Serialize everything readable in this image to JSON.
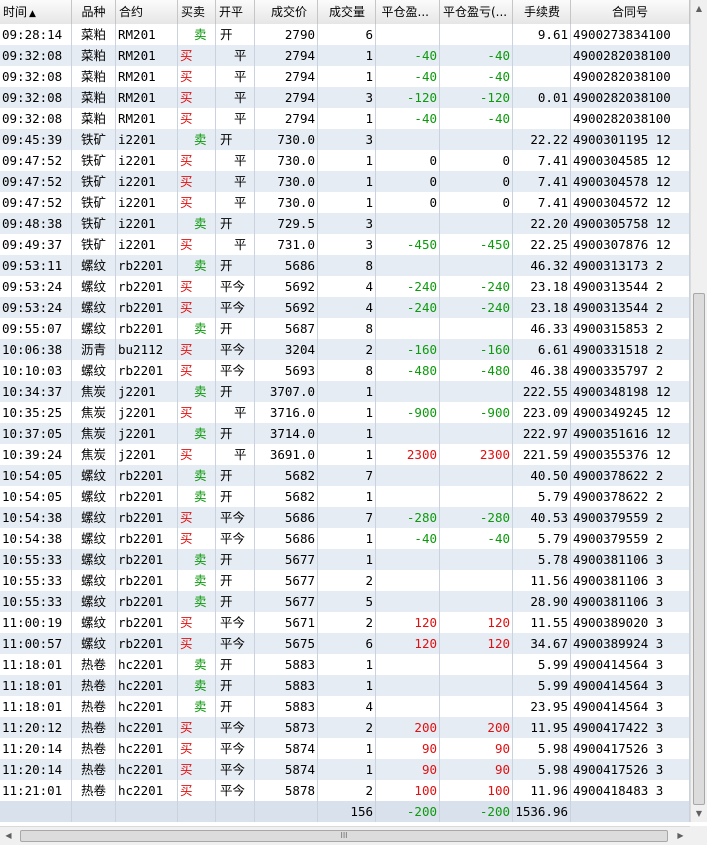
{
  "columns": [
    "时间",
    "品种",
    "合约",
    "买卖",
    "开平",
    "成交价",
    "成交量",
    "平仓盈...",
    "平仓盈亏(...",
    "手续费",
    "合同号"
  ],
  "sort_arrow": "▲",
  "rows": [
    [
      "09:28:14",
      "菜粕",
      "RM201",
      "卖",
      "开",
      "2790",
      "6",
      "",
      "",
      "9.61",
      "4900273834100"
    ],
    [
      "09:32:08",
      "菜粕",
      "RM201",
      "买",
      "平",
      "2794",
      "1",
      "-40",
      "-40",
      "",
      "4900282038100"
    ],
    [
      "09:32:08",
      "菜粕",
      "RM201",
      "买",
      "平",
      "2794",
      "1",
      "-40",
      "-40",
      "",
      "4900282038100"
    ],
    [
      "09:32:08",
      "菜粕",
      "RM201",
      "买",
      "平",
      "2794",
      "3",
      "-120",
      "-120",
      "0.01",
      "4900282038100"
    ],
    [
      "09:32:08",
      "菜粕",
      "RM201",
      "买",
      "平",
      "2794",
      "1",
      "-40",
      "-40",
      "",
      "4900282038100"
    ],
    [
      "09:45:39",
      "铁矿",
      "i2201",
      "卖",
      "开",
      "730.0",
      "3",
      "",
      "",
      "22.22",
      "4900301195 12"
    ],
    [
      "09:47:52",
      "铁矿",
      "i2201",
      "买",
      "平",
      "730.0",
      "1",
      "0",
      "0",
      "7.41",
      "4900304585 12"
    ],
    [
      "09:47:52",
      "铁矿",
      "i2201",
      "买",
      "平",
      "730.0",
      "1",
      "0",
      "0",
      "7.41",
      "4900304578 12"
    ],
    [
      "09:47:52",
      "铁矿",
      "i2201",
      "买",
      "平",
      "730.0",
      "1",
      "0",
      "0",
      "7.41",
      "4900304572 12"
    ],
    [
      "09:48:38",
      "铁矿",
      "i2201",
      "卖",
      "开",
      "729.5",
      "3",
      "",
      "",
      "22.20",
      "4900305758 12"
    ],
    [
      "09:49:37",
      "铁矿",
      "i2201",
      "买",
      "平",
      "731.0",
      "3",
      "-450",
      "-450",
      "22.25",
      "4900307876 12"
    ],
    [
      "09:53:11",
      "螺纹",
      "rb2201",
      "卖",
      "开",
      "5686",
      "8",
      "",
      "",
      "46.32",
      "4900313173 2"
    ],
    [
      "09:53:24",
      "螺纹",
      "rb2201",
      "买",
      "平今",
      "5692",
      "4",
      "-240",
      "-240",
      "23.18",
      "4900313544 2"
    ],
    [
      "09:53:24",
      "螺纹",
      "rb2201",
      "买",
      "平今",
      "5692",
      "4",
      "-240",
      "-240",
      "23.18",
      "4900313544 2"
    ],
    [
      "09:55:07",
      "螺纹",
      "rb2201",
      "卖",
      "开",
      "5687",
      "8",
      "",
      "",
      "46.33",
      "4900315853 2"
    ],
    [
      "10:06:38",
      "沥青",
      "bu2112",
      "买",
      "平今",
      "3204",
      "2",
      "-160",
      "-160",
      "6.61",
      "4900331518 2"
    ],
    [
      "10:10:03",
      "螺纹",
      "rb2201",
      "买",
      "平今",
      "5693",
      "8",
      "-480",
      "-480",
      "46.38",
      "4900335797 2"
    ],
    [
      "10:34:37",
      "焦炭",
      "j2201",
      "卖",
      "开",
      "3707.0",
      "1",
      "",
      "",
      "222.55",
      "4900348198 12"
    ],
    [
      "10:35:25",
      "焦炭",
      "j2201",
      "买",
      "平",
      "3716.0",
      "1",
      "-900",
      "-900",
      "223.09",
      "4900349245 12"
    ],
    [
      "10:37:05",
      "焦炭",
      "j2201",
      "卖",
      "开",
      "3714.0",
      "1",
      "",
      "",
      "222.97",
      "4900351616 12"
    ],
    [
      "10:39:24",
      "焦炭",
      "j2201",
      "买",
      "平",
      "3691.0",
      "1",
      "2300",
      "2300",
      "221.59",
      "4900355376 12"
    ],
    [
      "10:54:05",
      "螺纹",
      "rb2201",
      "卖",
      "开",
      "5682",
      "7",
      "",
      "",
      "40.50",
      "4900378622 2"
    ],
    [
      "10:54:05",
      "螺纹",
      "rb2201",
      "卖",
      "开",
      "5682",
      "1",
      "",
      "",
      "5.79",
      "4900378622 2"
    ],
    [
      "10:54:38",
      "螺纹",
      "rb2201",
      "买",
      "平今",
      "5686",
      "7",
      "-280",
      "-280",
      "40.53",
      "4900379559 2"
    ],
    [
      "10:54:38",
      "螺纹",
      "rb2201",
      "买",
      "平今",
      "5686",
      "1",
      "-40",
      "-40",
      "5.79",
      "4900379559 2"
    ],
    [
      "10:55:33",
      "螺纹",
      "rb2201",
      "卖",
      "开",
      "5677",
      "1",
      "",
      "",
      "5.78",
      "4900381106 3"
    ],
    [
      "10:55:33",
      "螺纹",
      "rb2201",
      "卖",
      "开",
      "5677",
      "2",
      "",
      "",
      "11.56",
      "4900381106 3"
    ],
    [
      "10:55:33",
      "螺纹",
      "rb2201",
      "卖",
      "开",
      "5677",
      "5",
      "",
      "",
      "28.90",
      "4900381106 3"
    ],
    [
      "11:00:19",
      "螺纹",
      "rb2201",
      "买",
      "平今",
      "5671",
      "2",
      "120",
      "120",
      "11.55",
      "4900389020 3"
    ],
    [
      "11:00:57",
      "螺纹",
      "rb2201",
      "买",
      "平今",
      "5675",
      "6",
      "120",
      "120",
      "34.67",
      "4900389924 3"
    ],
    [
      "11:18:01",
      "热卷",
      "hc2201",
      "卖",
      "开",
      "5883",
      "1",
      "",
      "",
      "5.99",
      "4900414564 3"
    ],
    [
      "11:18:01",
      "热卷",
      "hc2201",
      "卖",
      "开",
      "5883",
      "1",
      "",
      "",
      "5.99",
      "4900414564 3"
    ],
    [
      "11:18:01",
      "热卷",
      "hc2201",
      "卖",
      "开",
      "5883",
      "4",
      "",
      "",
      "23.95",
      "4900414564 3"
    ],
    [
      "11:20:12",
      "热卷",
      "hc2201",
      "买",
      "平今",
      "5873",
      "2",
      "200",
      "200",
      "11.95",
      "4900417422 3"
    ],
    [
      "11:20:14",
      "热卷",
      "hc2201",
      "买",
      "平今",
      "5874",
      "1",
      "90",
      "90",
      "5.98",
      "4900417526 3"
    ],
    [
      "11:20:14",
      "热卷",
      "hc2201",
      "买",
      "平今",
      "5874",
      "1",
      "90",
      "90",
      "5.98",
      "4900417526 3"
    ],
    [
      "11:21:01",
      "热卷",
      "hc2201",
      "买",
      "平今",
      "5878",
      "2",
      "100",
      "100",
      "11.96",
      "4900418483 3"
    ]
  ],
  "totals": {
    "volume": "156",
    "close_pnl": "-200",
    "close_pnl2": "-200",
    "fee": "1536.96"
  },
  "colors": {
    "buy": "#e01010",
    "sell": "#0c9a0c",
    "row_alt": "#e6ecf4",
    "total_row": "#d9e1ec"
  },
  "scrollbar": {
    "h_grip": "III",
    "up_icon": "triangle-up-icon",
    "down_icon": "triangle-down-icon",
    "left_icon": "triangle-left-icon",
    "right_icon": "triangle-right-icon"
  }
}
